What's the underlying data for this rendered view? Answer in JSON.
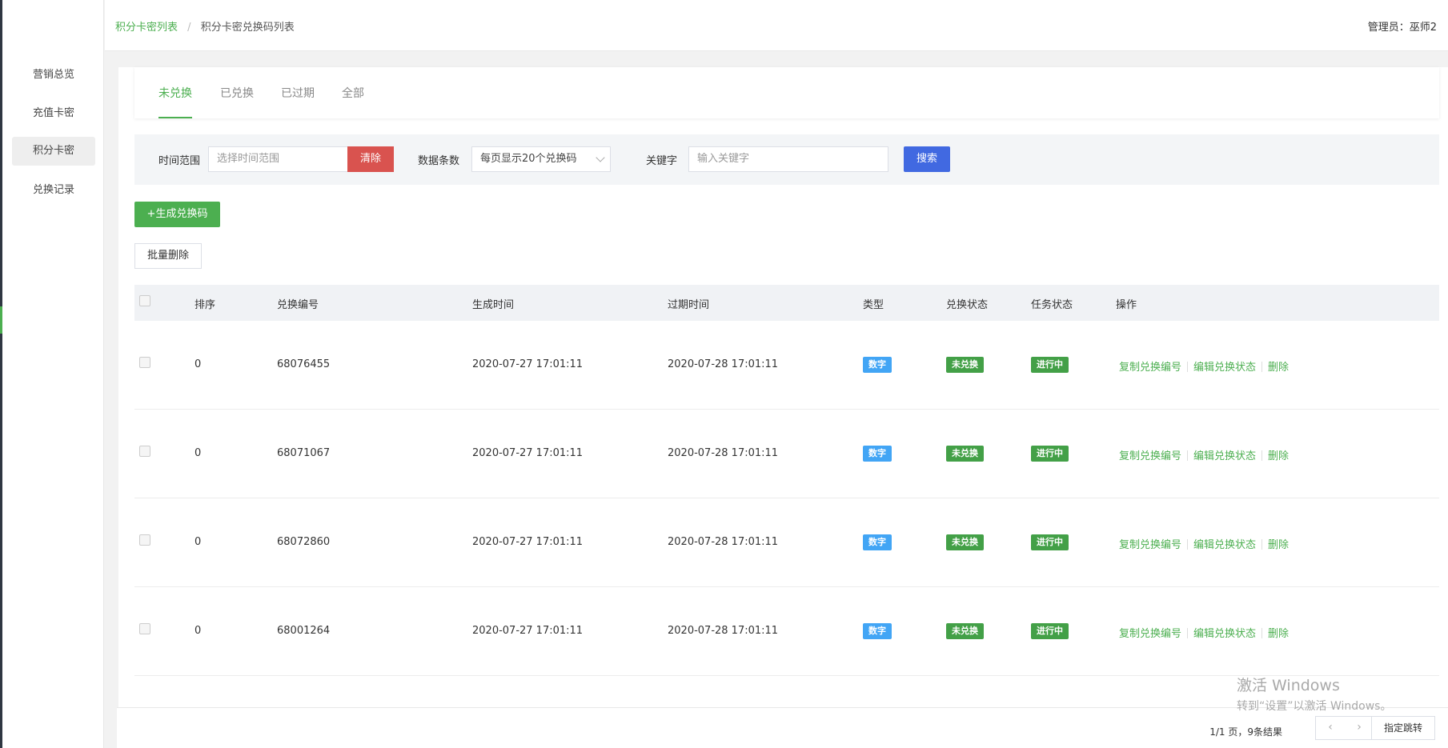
{
  "breadcrumb": {
    "link": "积分卡密列表",
    "separator": "/",
    "current": "积分卡密兑换码列表"
  },
  "admin": {
    "label": "管理员：",
    "name": "巫师2"
  },
  "sidebar": {
    "items": [
      {
        "label": "营销总览"
      },
      {
        "label": "充值卡密"
      },
      {
        "label": "积分卡密"
      },
      {
        "label": "兑换记录"
      }
    ]
  },
  "tabs": [
    {
      "label": "未兑换"
    },
    {
      "label": "已兑换"
    },
    {
      "label": "已过期"
    },
    {
      "label": "全部"
    }
  ],
  "filter": {
    "time_label": "时间范围",
    "time_placeholder": "选择时间范围",
    "clear_label": "清除",
    "count_label": "数据条数",
    "count_value": "每页显示20个兑换码",
    "keyword_label": "关键字",
    "keyword_placeholder": "输入关键字",
    "search_label": "搜索"
  },
  "actions": {
    "generate_label": "+生成兑换码",
    "batch_delete_label": "批量删除"
  },
  "table": {
    "headers": [
      "排序",
      "兑换编号",
      "生成时间",
      "过期时间",
      "类型",
      "兑换状态",
      "任务状态",
      "操作"
    ],
    "ops": [
      "复制兑换编号",
      "编辑兑换状态",
      "删除"
    ],
    "rows": [
      {
        "order": "0",
        "code": "68076455",
        "created": "2020-07-27 17:01:11",
        "expires": "2020-07-28 17:01:11",
        "type": "数字",
        "redeem_status": "未兑换",
        "task_status": "进行中"
      },
      {
        "order": "0",
        "code": "68071067",
        "created": "2020-07-27 17:01:11",
        "expires": "2020-07-28 17:01:11",
        "type": "数字",
        "redeem_status": "未兑换",
        "task_status": "进行中"
      },
      {
        "order": "0",
        "code": "68072860",
        "created": "2020-07-27 17:01:11",
        "expires": "2020-07-28 17:01:11",
        "type": "数字",
        "redeem_status": "未兑换",
        "task_status": "进行中"
      },
      {
        "order": "0",
        "code": "68001264",
        "created": "2020-07-27 17:01:11",
        "expires": "2020-07-28 17:01:11",
        "type": "数字",
        "redeem_status": "未兑换",
        "task_status": "进行中"
      }
    ]
  },
  "pagination": {
    "info": "1/1 页，9条结果",
    "prev": "‹",
    "next": "›",
    "jump_label": "指定跳转"
  },
  "watermark": {
    "line1": "激活 Windows",
    "line2": "转到“设置”以激活 Windows。"
  },
  "colors": {
    "accent": "#4caf50",
    "danger": "#d9534f",
    "primary": "#4169e1",
    "badge_blue": "#42a5f5",
    "badge_green": "#43a047"
  }
}
